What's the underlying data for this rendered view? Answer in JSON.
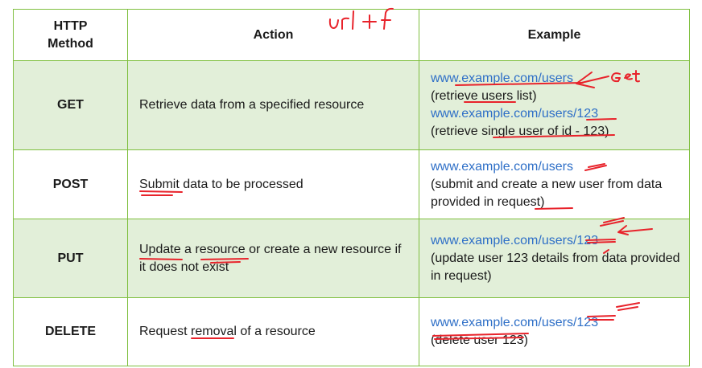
{
  "table": {
    "headers": {
      "method": "HTTP Method",
      "action": "Action",
      "example": "Example"
    },
    "rows": [
      {
        "method": "GET",
        "action": "Retrieve data from a specified resource",
        "examples": [
          {
            "url": "www.example.com/users",
            "desc": "(retrieve users list)"
          },
          {
            "url": "www.example.com/users/123",
            "desc": "(retrieve single user of id - 123)"
          }
        ]
      },
      {
        "method": "POST",
        "action": "Submit data to be processed",
        "examples": [
          {
            "url": "www.example.com/users",
            "desc": "(submit and create a new user from data provided in request)"
          }
        ]
      },
      {
        "method": "PUT",
        "action": "Update a resource or create a new resource if it does not exist",
        "examples": [
          {
            "url": "www.example.com/users/123",
            "desc": "(update user 123 details from data provided in request)"
          }
        ]
      },
      {
        "method": "DELETE",
        "action": "Request removal of a resource",
        "examples": [
          {
            "url": "www.example.com/users/123",
            "desc": "(delete user 123)"
          }
        ]
      }
    ]
  },
  "annotations": {
    "header_note": "url + f",
    "get_note": "Get"
  },
  "colors": {
    "border": "#7fbf3f",
    "row_shade": "#e2efd9",
    "link": "#2e6fc7",
    "ink": "#e8232b"
  }
}
